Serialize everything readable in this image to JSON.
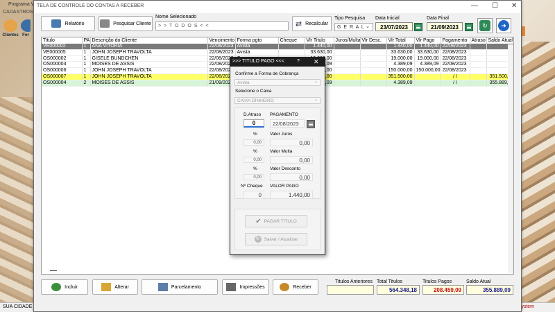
{
  "background": {
    "title": "Programa V",
    "menu": "CADASTROS",
    "icons": [
      {
        "label": "Clientes"
      },
      {
        "label": "For"
      }
    ],
    "status_left": "SUA CIDADE -",
    "status_right": "System"
  },
  "window": {
    "title": "TELA DE CONTROLE DO CONTAS A RECEBER",
    "controls": {
      "minimize": "—",
      "maximize": "☐",
      "close": "✕"
    }
  },
  "toolbar": {
    "relatorio": "Relatório",
    "pesquisar_cliente": "Pesquisar Cliente",
    "nome_label": "Nome Selecionado",
    "nome_value": "> > T O D O S < <",
    "recalcular": "Recalcular",
    "tipo_label": "Tipo  Pesquisa",
    "tipo_value": "G E R A L",
    "data_inicial_label": "Data Inicial",
    "data_inicial": "23/07/2023",
    "data_final_label": "Data Final",
    "data_final": "21/09/2023",
    "gerar_label": "GERAR"
  },
  "grid": {
    "columns": [
      "Titulo",
      "PA",
      "Descrição do Cliente",
      "Vencimento",
      "Forma pgto",
      "Cheque",
      "Vlr Titulo",
      "Juros/Multa",
      "Vlr Desc.",
      "Vlr Total",
      "Vlr Pago",
      "Pagamento",
      "Atraso",
      "Saldo Atual"
    ],
    "rows": [
      {
        "style": "r-sel",
        "cells": [
          "VE000002",
          "1",
          "ANA VITORIA",
          "22/08/2023",
          "Avista",
          "",
          "1.440,00",
          "",
          "",
          "1.440,00",
          "1.440,00",
          "22/08/2023",
          "",
          ""
        ]
      },
      {
        "style": "",
        "cells": [
          "VE000005",
          "1",
          "JOHN JOSEPH TRAVOLTA",
          "22/08/2023",
          "Avista",
          "",
          "33.630,00",
          "",
          "",
          "33.630,00",
          "33.630,00",
          "22/08/2023",
          "",
          ""
        ]
      },
      {
        "style": "",
        "cells": [
          "OS000002",
          "1",
          "GISELE BÜNDCHEN",
          "22/08/2023",
          "Ca",
          "",
          "19.000,00",
          "",
          "",
          "19.000,00",
          "19.000,00",
          "22/08/2023",
          "",
          ""
        ]
      },
      {
        "style": "",
        "cells": [
          "OS000004",
          "1",
          "MOISES DE ASSIS",
          "22/08/2023",
          "Ca",
          "",
          "4.389,09",
          "",
          "",
          "4.389,09",
          "4.389,09",
          "22/08/2023",
          "",
          ""
        ]
      },
      {
        "style": "",
        "cells": [
          "OS000006",
          "1",
          "JOHN JOSEPH TRAVOLTA",
          "22/08/2023",
          "Ac",
          "",
          "150.000,00",
          "",
          "",
          "150.000,00",
          "150.000,00",
          "22/08/2023",
          "",
          ""
        ]
      },
      {
        "style": "r-yel",
        "cells": [
          "OS000007",
          "1",
          "JOHN JOSEPH TRAVOLTA",
          "22/08/2023",
          "Ac",
          "",
          "351.500,00",
          "",
          "",
          "351.500,00",
          "",
          "/ /",
          "",
          "351.500,00"
        ]
      },
      {
        "style": "r-grn",
        "cells": [
          "OS000004",
          "2",
          "MOISES DE ASSIS",
          "21/09/2023",
          "Ca",
          "",
          "4.389,09",
          "",
          "",
          "4.389,09",
          "",
          "/ /",
          "",
          "355.889,09"
        ]
      }
    ]
  },
  "bottom": {
    "incluir": "Incluir",
    "alterar": "Alterar",
    "parcelamento": "Parcelamento",
    "impressoes": "Impressões",
    "receber": "Receber",
    "titulos_anteriores_label": "Titulos Anteriores",
    "titulos_anteriores": "",
    "total_titulos_label": "Total Titulos",
    "total_titulos": "564.348,18",
    "titulos_pagos_label": "Titulos Pagos",
    "titulos_pagos": "208.459,09",
    "saldo_atual_label": "Saldo Atual",
    "saldo_atual": "355.889,09"
  },
  "dialog": {
    "title": ">>> TITULO PAGO <<<",
    "help": "?",
    "close": "✕",
    "forma_label": "Confirme a Forma de Cobrança",
    "forma_value": "Avista",
    "caixa_label": "Selecione o Caixa",
    "caixa_value": "CAIXA DINHEIRO",
    "d_atraso_label": "D.Atraso",
    "d_atraso": "0",
    "pagamento_label": "PAGAMENTO",
    "pagamento": "22/08/2023",
    "pct_label": "%",
    "juros_pct": "0,00",
    "valor_juros_label": "Valor Juros",
    "valor_juros": "0,00",
    "multa_pct": "0,00",
    "valor_multa_label": "Valor Multa",
    "valor_multa": "0,00",
    "desc_pct": "0,00",
    "valor_desconto_label": "Valor Desconto",
    "valor_desconto": "0,00",
    "n_cheque_label": "Nº Cheque",
    "n_cheque": "0",
    "valor_pago_label": "VALOR PAGO",
    "valor_pago": "1.440,00",
    "pagar_titulo": "PAGAR TITULO",
    "salvar": "Salvar / Atualizar"
  }
}
